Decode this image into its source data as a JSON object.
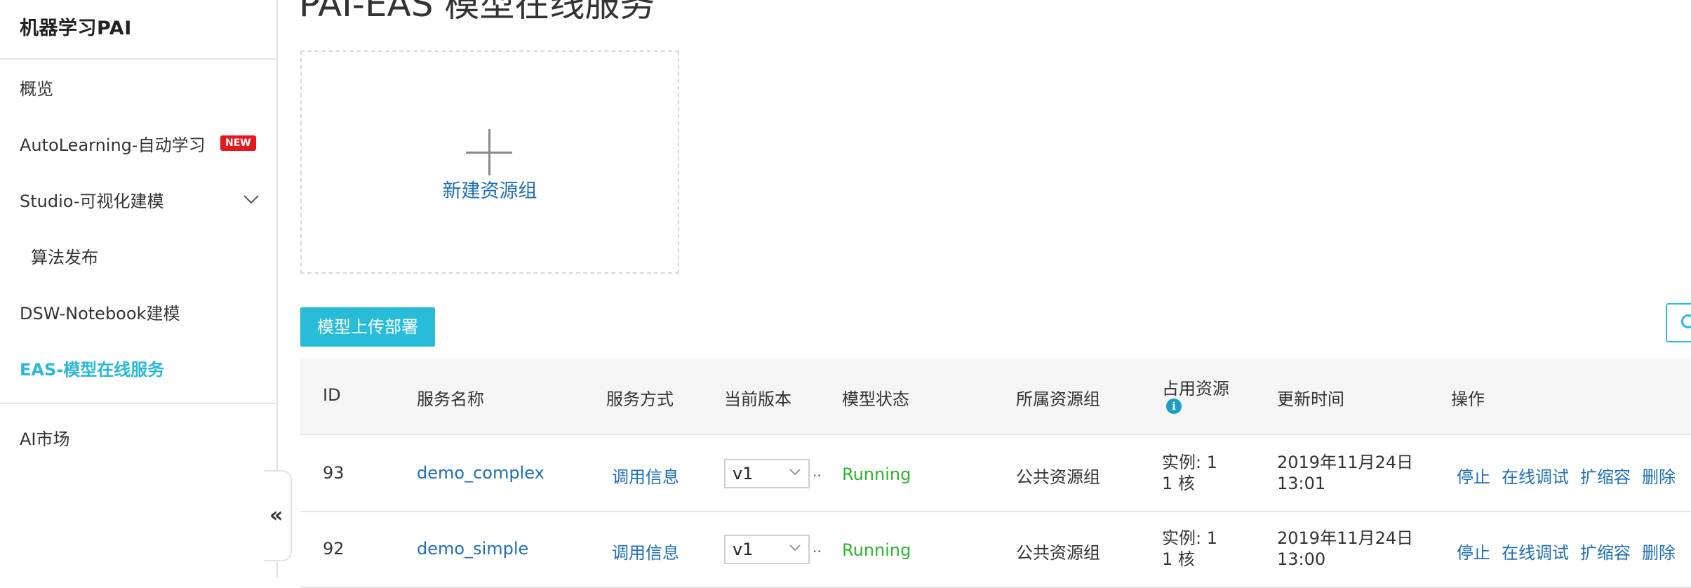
{
  "sidebar": {
    "brand": "机器学习PAI",
    "items": [
      {
        "label": "概览"
      },
      {
        "label": "AutoLearning-自动学习",
        "badge": "NEW"
      },
      {
        "label": "Studio-可视化建模"
      },
      {
        "label": "算法发布"
      },
      {
        "label": "DSW-Notebook建模"
      },
      {
        "label": "EAS-模型在线服务",
        "active": true
      },
      {
        "label": "AI市场"
      }
    ],
    "collapse_icon": "«"
  },
  "page": {
    "title": "PAI-EAS 模型在线服务"
  },
  "create_card": {
    "label": "新建资源组",
    "icon": "plus-icon"
  },
  "toolbar": {
    "deploy_label": "模型上传部署",
    "search_icon": "search-icon"
  },
  "table": {
    "columns": [
      "ID",
      "服务名称",
      "服务方式",
      "当前版本",
      "模型状态",
      "所属资源组",
      "占用资源",
      "更新时间",
      "操作"
    ],
    "rows": [
      {
        "id": "93",
        "name": "demo_complex",
        "method": "调用信息",
        "version": "v1",
        "status": "Running",
        "group": "公共资源组",
        "resource_instances": "实例: 1",
        "resource_cores": "1 核",
        "updated_date": "2019年11月24日",
        "updated_time": "13:01",
        "actions": [
          "停止",
          "在线调试",
          "扩缩容",
          "删除"
        ]
      },
      {
        "id": "92",
        "name": "demo_simple",
        "method": "调用信息",
        "version": "v1",
        "status": "Running",
        "group": "公共资源组",
        "resource_instances": "实例: 1",
        "resource_cores": "1 核",
        "updated_date": "2019年11月24日",
        "updated_time": "13:00",
        "actions": [
          "停止",
          "在线调试",
          "扩缩容",
          "删除"
        ]
      }
    ]
  },
  "colors": {
    "accent": "#29bcd9",
    "link": "#1f6fb5",
    "running": "#2ab52a",
    "badge": "#e5181f"
  }
}
